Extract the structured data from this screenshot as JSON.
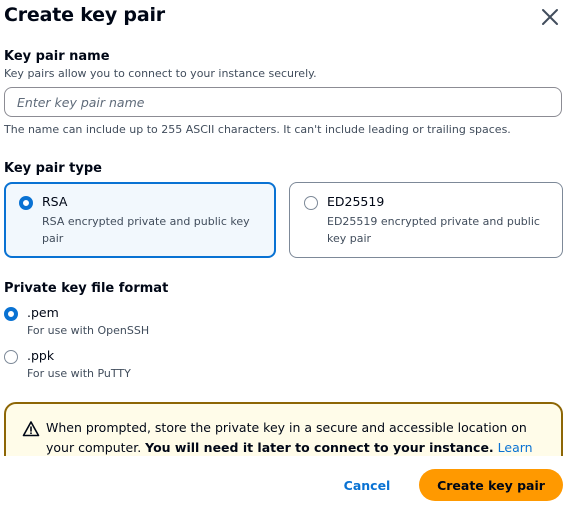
{
  "modal": {
    "title": "Create key pair"
  },
  "key_pair_name": {
    "label": "Key pair name",
    "description": "Key pairs allow you to connect to your instance securely.",
    "value": "",
    "placeholder": "Enter key pair name",
    "constraint": "The name can include up to 255 ASCII characters. It can't include leading or trailing spaces."
  },
  "key_pair_type": {
    "label": "Key pair type",
    "selected": "RSA",
    "options": [
      {
        "title": "RSA",
        "description": "RSA encrypted private and public key pair"
      },
      {
        "title": "ED25519",
        "description": "ED25519 encrypted private and public key pair"
      }
    ]
  },
  "file_format": {
    "label": "Private key file format",
    "selected": ".pem",
    "options": [
      {
        "title": ".pem",
        "description": "For use with OpenSSH"
      },
      {
        "title": ".ppk",
        "description": "For use with PuTTY"
      }
    ]
  },
  "alert": {
    "text_before": "When prompted, store the private key in a secure and accessible location on your computer. ",
    "text_bold": "You will need it later to connect to your instance.",
    "link_text": "Learn"
  },
  "footer": {
    "cancel_label": "Cancel",
    "create_label": "Create key pair"
  },
  "colors": {
    "accent": "#0972d3",
    "primary_button": "#ff9900",
    "warning_border": "#8d6605",
    "warning_background": "#fffce9"
  }
}
